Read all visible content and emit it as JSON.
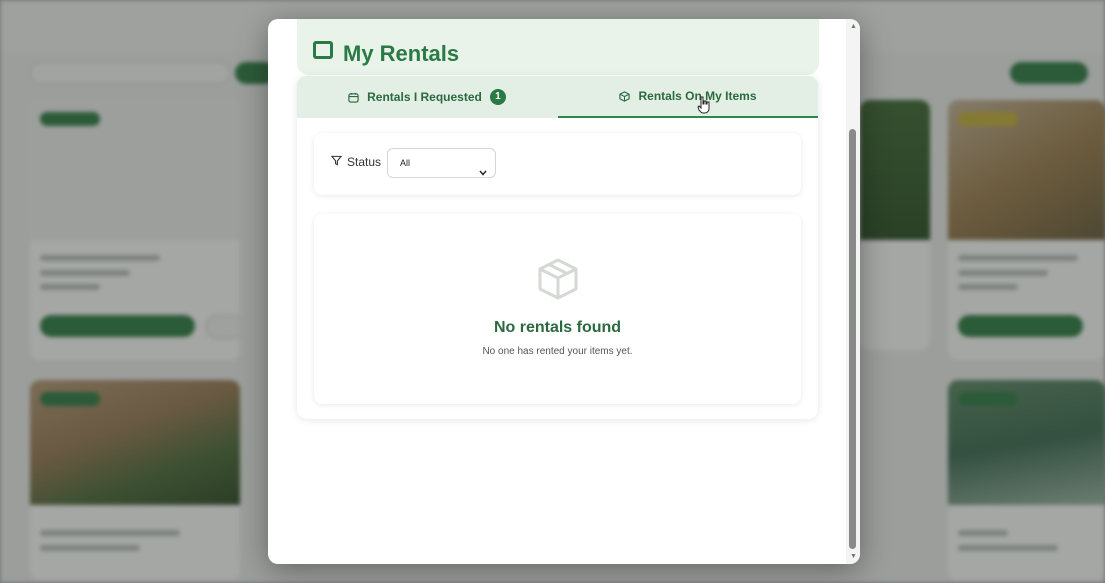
{
  "modal": {
    "title": "My Rentals",
    "tabs": [
      {
        "label": "Rentals I Requested",
        "badge": "1",
        "icon": "calendar-icon",
        "active": false
      },
      {
        "label": "Rentals On My Items",
        "icon": "box-icon",
        "active": true
      }
    ],
    "filter": {
      "label": "Status",
      "icon": "filter-icon",
      "selected": "All"
    },
    "empty_state": {
      "icon": "box-icon",
      "title": "No rentals found",
      "message": "No one has rented your items yet."
    }
  },
  "colors": {
    "accent": "#2a7a45",
    "tab_bar": "#e3efe4",
    "header_bg": "#e9f3ea",
    "overlay": "rgba(40,45,40,0.42)"
  }
}
